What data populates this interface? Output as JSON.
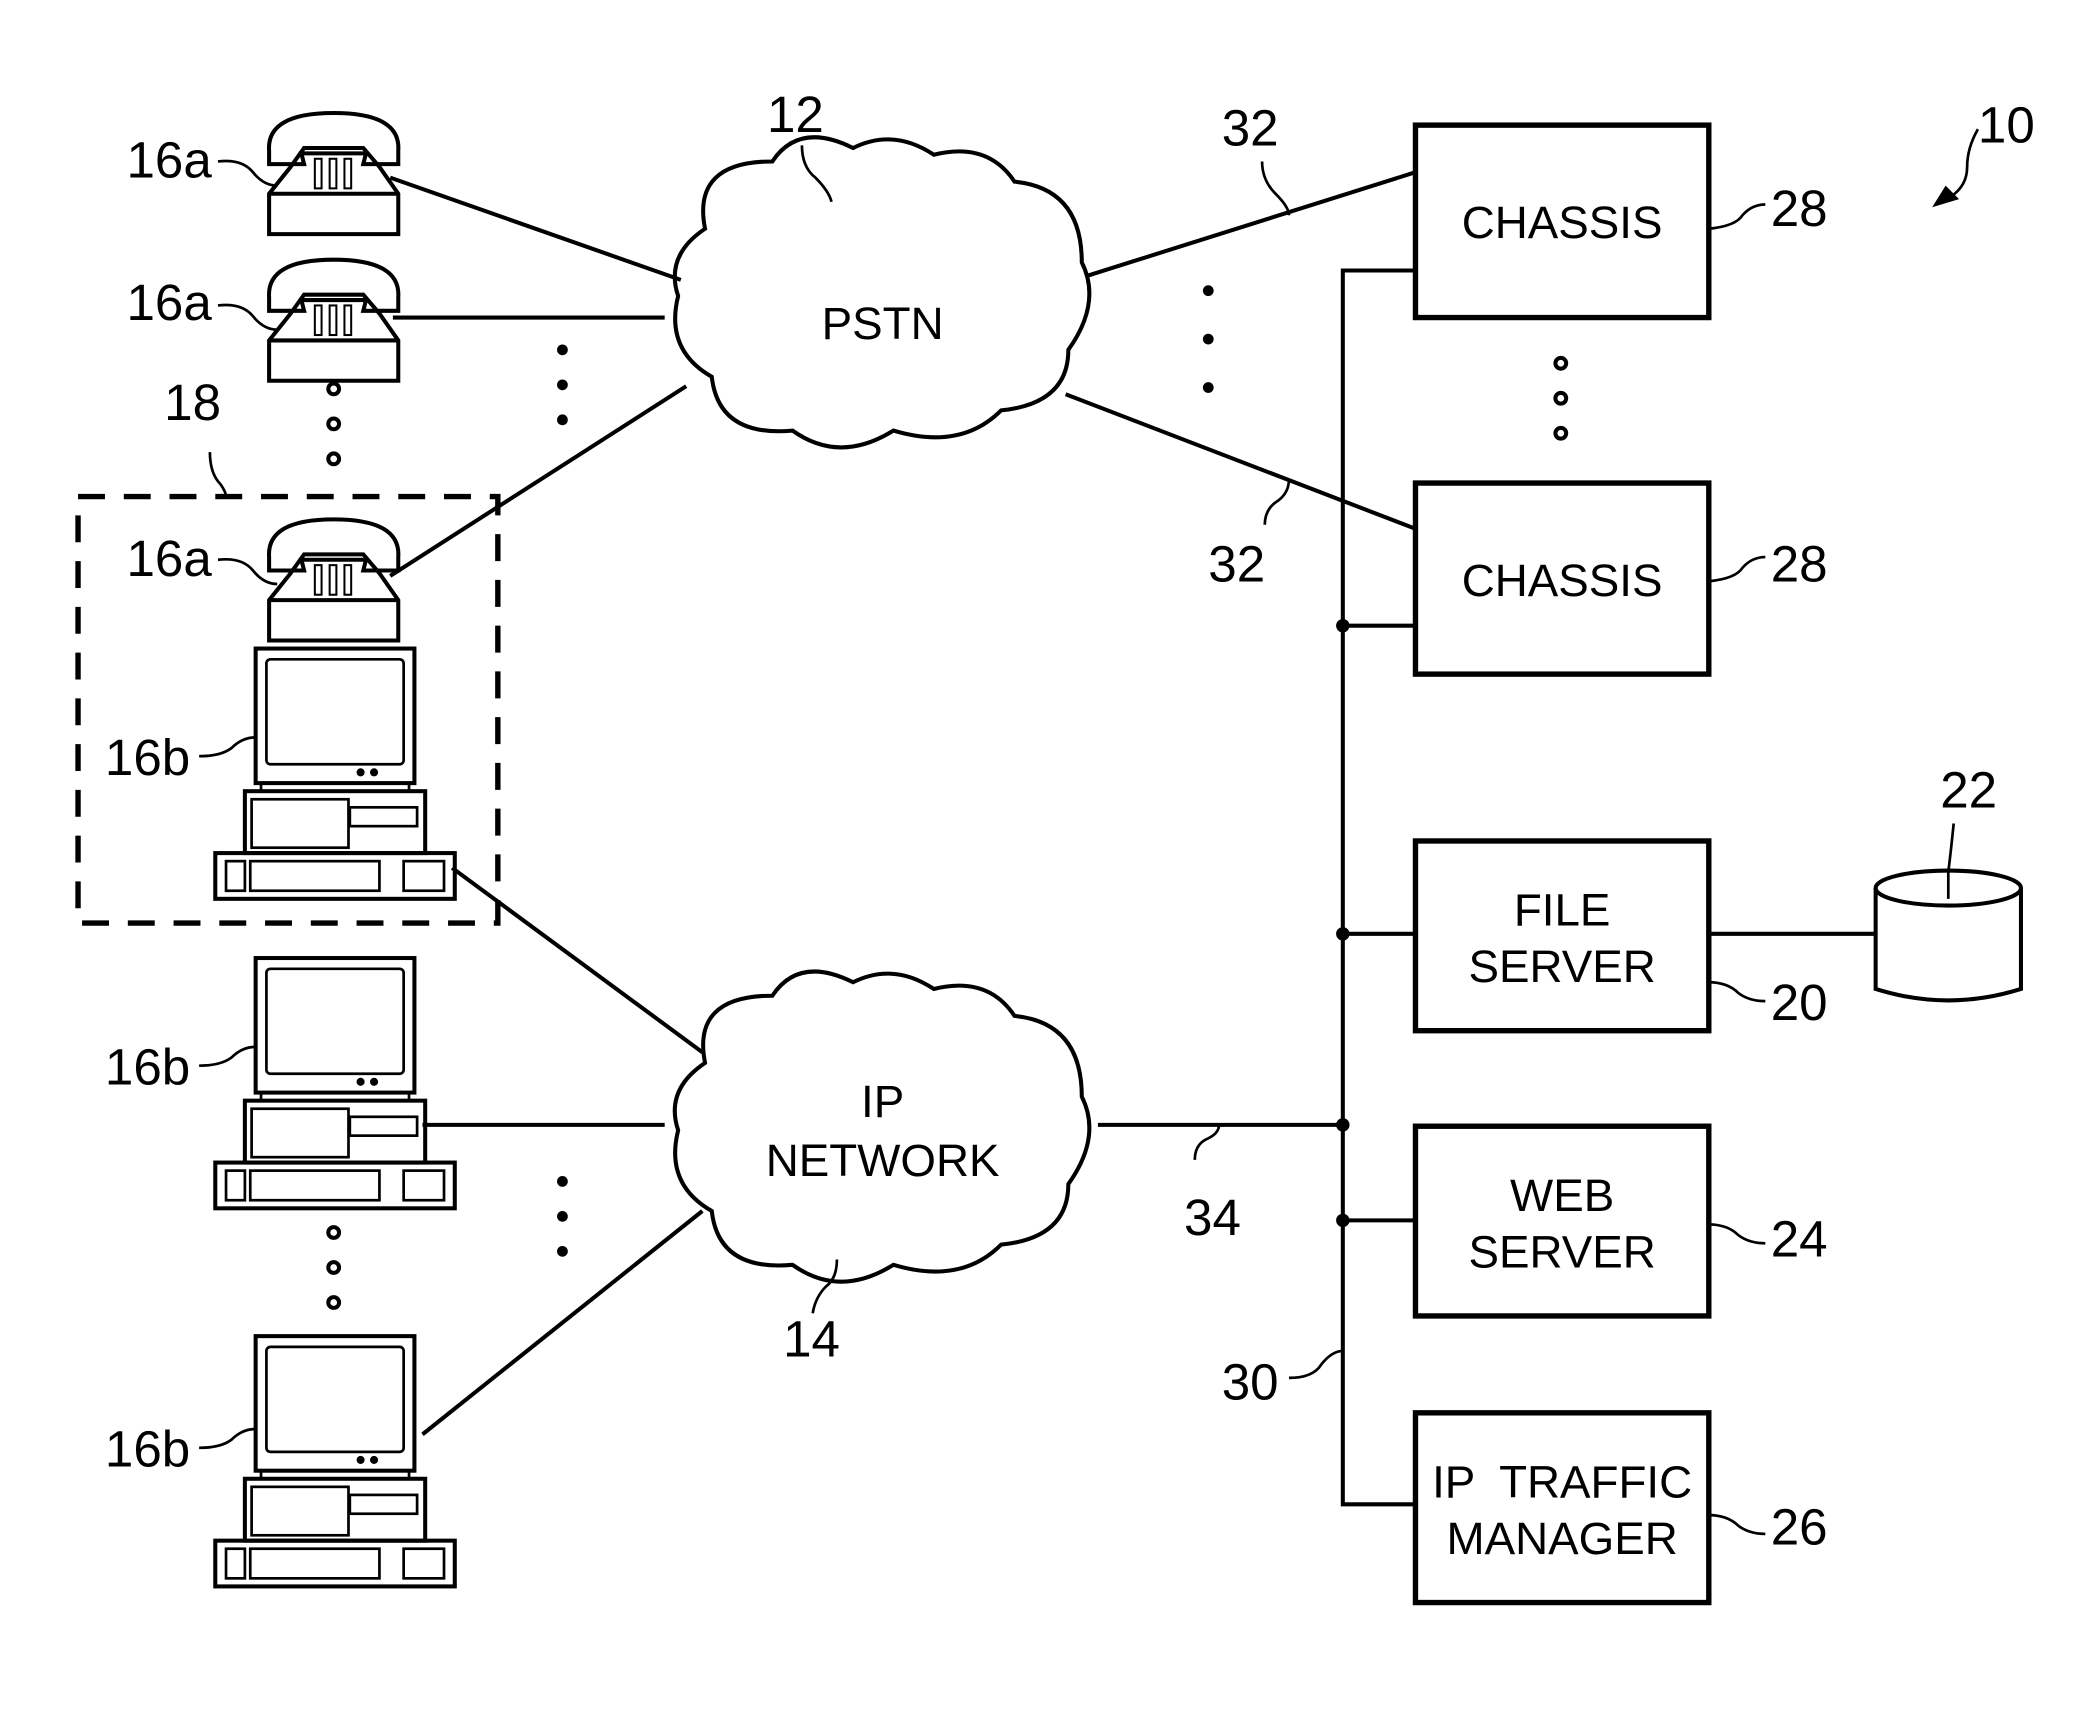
{
  "figure": {
    "ref": "10",
    "networks": {
      "pstn": {
        "label": "PSTN",
        "ref": "12"
      },
      "ip": {
        "label_line1": "IP",
        "label_line2": "NETWORK",
        "ref": "14"
      }
    },
    "phones": [
      {
        "ref": "16a"
      },
      {
        "ref": "16a"
      },
      {
        "ref": "16a"
      }
    ],
    "computers": [
      {
        "ref": "16b"
      },
      {
        "ref": "16b"
      },
      {
        "ref": "16b"
      }
    ],
    "group_ref": "18",
    "boxes": {
      "chassis1": {
        "line1": "CHASSIS",
        "ref": "28"
      },
      "chassis2": {
        "line1": "CHASSIS",
        "ref": "28"
      },
      "file_server": {
        "line1": "FILE",
        "line2": "SERVER",
        "ref": "20"
      },
      "web_server": {
        "line1": "WEB",
        "line2": "SERVER",
        "ref": "24"
      },
      "ip_traffic_manager": {
        "line1": "IP  TRAFFIC",
        "line2": "MANAGER",
        "ref": "26"
      }
    },
    "database_ref": "22",
    "links": {
      "pstn_chassis_top": "32",
      "pstn_chassis_bottom": "32",
      "ip_lan": "34",
      "lan_bus": "30"
    }
  }
}
